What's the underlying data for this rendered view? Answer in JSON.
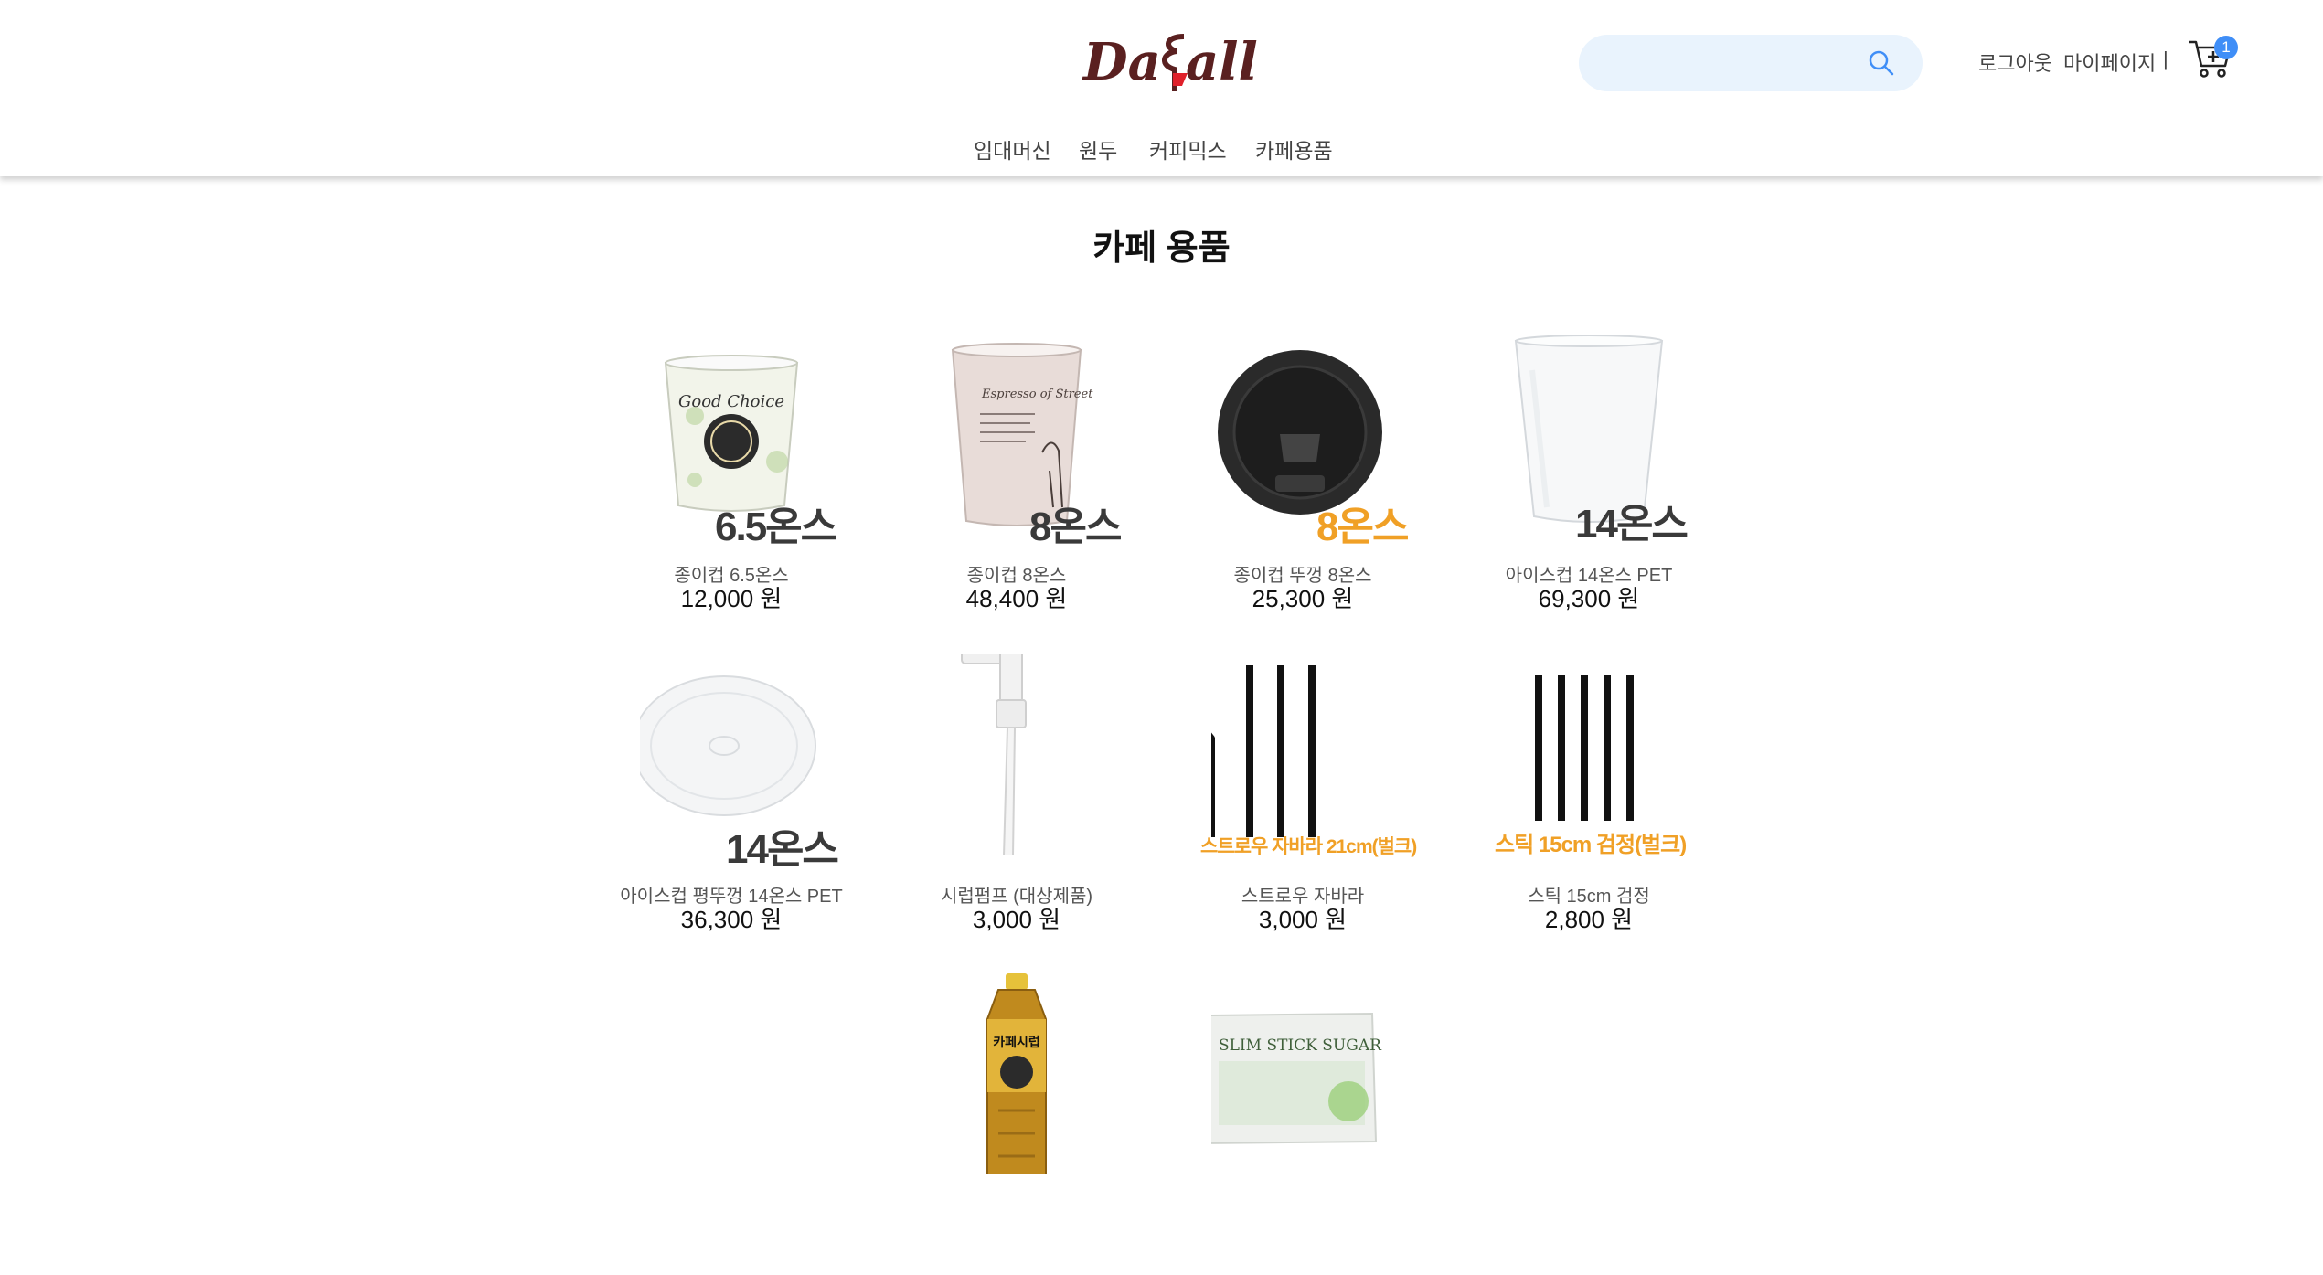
{
  "header": {
    "logo_text": "DaEall",
    "search_placeholder": "",
    "logout_label": "로그아웃",
    "mypage_label": "마이페이지",
    "separator": "|",
    "cart_count": "1",
    "nav": [
      "임대머신",
      "원두",
      "커피믹스",
      "카페용품"
    ]
  },
  "page": {
    "title": "카페 용품"
  },
  "products": [
    {
      "overlay": "6.5온스",
      "name": "종이컵 6.5온스",
      "price": "12,000 원"
    },
    {
      "overlay": "8온스",
      "name": "종이컵 8온스",
      "price": "48,400 원"
    },
    {
      "overlay": "8온스",
      "name": "종이컵 뚜껑 8온스",
      "price": "25,300 원"
    },
    {
      "overlay": "14온스",
      "name": "아이스컵 14온스 PET",
      "price": "69,300 원"
    },
    {
      "overlay": "14온스",
      "name": "아이스컵 평뚜껑 14온스 PET",
      "price": "36,300 원"
    },
    {
      "overlay": "",
      "name": "시럽펌프 (대상제품)",
      "price": "3,000 원"
    },
    {
      "overlay": "스트로우 자바라 21cm(벌크)",
      "name": "스트로우 자바라",
      "price": "3,000 원"
    },
    {
      "overlay": "스틱 15cm 검정(벌크)",
      "name": "스틱 15cm 검정",
      "price": "2,800 원"
    },
    {
      "overlay": "",
      "name": "",
      "price": ""
    },
    {
      "overlay": "",
      "name": "",
      "price": ""
    }
  ],
  "product_labels": {
    "cup1_brand": "Good Choice",
    "cup2_brand": "Espresso of Street",
    "syrup_label": "카페시럽",
    "sugar_label": "SLIM STICK SUGAR"
  },
  "colors": {
    "accent": "#f0a026",
    "search_bg": "#e9f3fd",
    "badge": "#3f8ef7",
    "logo": "#5a2020"
  }
}
